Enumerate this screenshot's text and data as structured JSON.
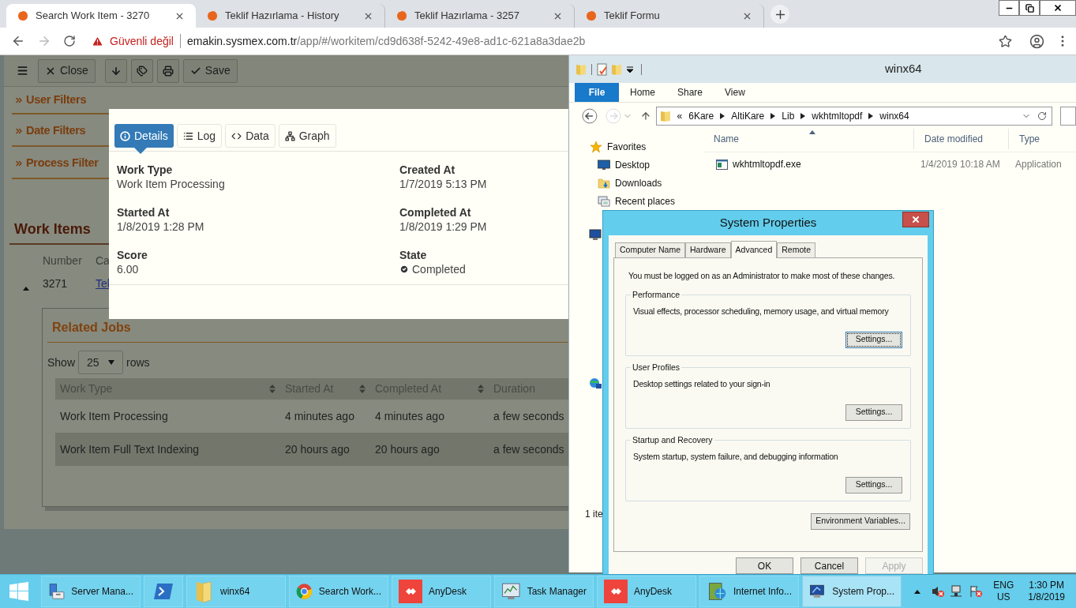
{
  "browser": {
    "tabs": [
      {
        "title": "Search Work Item - 3270",
        "selected": true
      },
      {
        "title": "Teklif Hazırlama - History",
        "selected": false
      },
      {
        "title": "Teklif Hazırlama - 3257",
        "selected": false
      },
      {
        "title": "Teklif Formu",
        "selected": false
      }
    ],
    "security": "Güvenli değil",
    "url_host": "emakin.sysmex.com.tr",
    "url_path": "/app/#/workitem/cd9d638f-5242-49e8-ad1c-621a8a3dae2b"
  },
  "toolbar": [
    {
      "kind": "menu"
    },
    {
      "kind": "close",
      "label": "Close"
    },
    {
      "kind": "download"
    },
    {
      "kind": "tags"
    },
    {
      "kind": "print"
    },
    {
      "kind": "save",
      "label": "Save"
    }
  ],
  "filters": [
    "User Filters",
    "Date Filters",
    "Process Filter"
  ],
  "work_items": {
    "title": "Work Items",
    "columns": [
      "Number",
      "Ca"
    ],
    "rows": [
      {
        "number": "3271",
        "link": "Tel",
        "expanded": true
      }
    ]
  },
  "related_jobs": {
    "title": "Related Jobs",
    "show_label": "Show",
    "page_size": "25",
    "rows_label": "rows",
    "columns": [
      {
        "label": "Work Type",
        "sortable": true
      },
      {
        "label": "Started At",
        "sortable": true
      },
      {
        "label": "Completed At",
        "sortable": true
      },
      {
        "label": "Duration",
        "sortable": false
      }
    ],
    "rows": [
      [
        "Work Item Processing",
        "4 minutes ago",
        "4 minutes ago",
        "a few seconds"
      ],
      [
        "Work Item Full Text Indexing",
        "20 hours ago",
        "20 hours ago",
        "a few seconds"
      ]
    ]
  },
  "details": {
    "tabs": [
      {
        "kind": "info",
        "label": "Details",
        "selected": true
      },
      {
        "kind": "list",
        "label": "Log",
        "selected": false
      },
      {
        "kind": "code",
        "label": "Data",
        "selected": false
      },
      {
        "kind": "graph",
        "label": "Graph",
        "selected": false
      }
    ],
    "fields": [
      {
        "kind": "text",
        "label": "Work Type",
        "value": "Work Item Processing"
      },
      {
        "kind": "text",
        "label": "Created At",
        "value": "1/7/2019 5:13 PM"
      },
      {
        "kind": "text",
        "label": "Started At",
        "value": "1/8/2019 1:28 PM"
      },
      {
        "kind": "text",
        "label": "Completed At",
        "value": "1/8/2019 1:29 PM"
      },
      {
        "kind": "text",
        "label": "Score",
        "value": "6.00"
      },
      {
        "kind": "status",
        "label": "State",
        "value": "Completed"
      }
    ]
  },
  "explorer": {
    "title": "winx64",
    "ribbon": [
      {
        "kind": "file",
        "label": "File"
      },
      {
        "kind": "tab",
        "label": "Home"
      },
      {
        "kind": "tab",
        "label": "Share"
      },
      {
        "kind": "tab",
        "label": "View"
      }
    ],
    "path_overflow": "«",
    "path": [
      "6Kare",
      "AltiKare",
      "Lib",
      "wkhtmltopdf",
      "winx64"
    ],
    "nav": [
      {
        "kind": "favorites",
        "label": "Favorites"
      },
      {
        "kind": "desktop",
        "label": "Desktop"
      },
      {
        "kind": "downloads",
        "label": "Downloads"
      },
      {
        "kind": "recent",
        "label": "Recent places"
      }
    ],
    "columns": [
      "Name",
      "Date modified",
      "Type"
    ],
    "files": [
      {
        "name": "wkhtmltopdf.exe",
        "date": "1/4/2019 10:18 AM",
        "type": "Application"
      }
    ],
    "status": "1 ite"
  },
  "system_properties": {
    "title": "System Properties",
    "tabs": [
      {
        "label": "Computer Name",
        "selected": false
      },
      {
        "label": "Hardware",
        "selected": false
      },
      {
        "label": "Advanced",
        "selected": true
      },
      {
        "label": "Remote",
        "selected": false
      }
    ],
    "note": "You must be logged on as an Administrator to make most of these changes.",
    "groups": [
      {
        "title": "Performance",
        "description": "Visual effects, processor scheduling, memory usage, and virtual memory",
        "button": "Settings...",
        "focused": true
      },
      {
        "title": "User Profiles",
        "description": "Desktop settings related to your sign-in",
        "button": "Settings...",
        "focused": false
      },
      {
        "title": "Startup and Recovery",
        "description": "System startup, system failure, and debugging information",
        "button": "Settings...",
        "focused": false
      }
    ],
    "env_button": "Environment Variables...",
    "buttons": [
      {
        "label": "OK",
        "disabled": false
      },
      {
        "label": "Cancel",
        "disabled": false
      },
      {
        "label": "Apply",
        "disabled": true
      }
    ]
  },
  "taskbar": {
    "items": [
      {
        "kind": "server",
        "label": "Server Mana...",
        "active": false
      },
      {
        "kind": "powershell",
        "active": false
      },
      {
        "kind": "folder",
        "label": "winx64",
        "active": false
      },
      {
        "kind": "chrome",
        "label": "Search Work...",
        "active": false
      },
      {
        "kind": "anydesk",
        "label": "AnyDesk",
        "active": false
      },
      {
        "kind": "taskmgr",
        "label": "Task Manager",
        "active": false
      },
      {
        "kind": "anydesk",
        "label": "AnyDesk",
        "active": false
      },
      {
        "kind": "iis",
        "label": "Internet Info...",
        "active": false
      },
      {
        "kind": "sysprop",
        "label": "System Prop...",
        "active": true
      }
    ],
    "tray": {
      "language": "ENG",
      "region": "US",
      "time": "1:30 PM",
      "date": "1/8/2019"
    }
  }
}
